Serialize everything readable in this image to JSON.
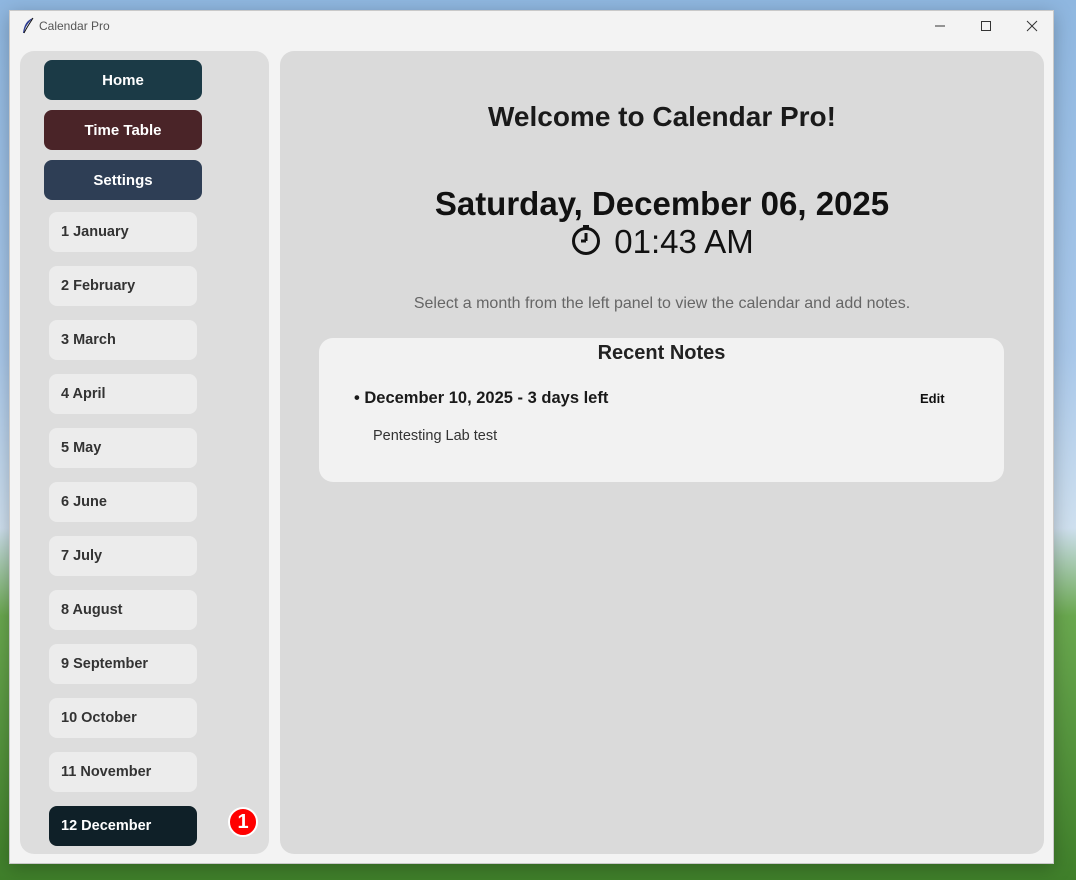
{
  "window": {
    "title": "Calendar Pro"
  },
  "sidebar": {
    "nav": [
      {
        "label": "Home",
        "color": "#1b3a46"
      },
      {
        "label": "Time Table",
        "color": "#4a2428"
      },
      {
        "label": "Settings",
        "color": "#2e3e55"
      }
    ],
    "months": [
      {
        "label": "1 January"
      },
      {
        "label": "2 February"
      },
      {
        "label": "3 March"
      },
      {
        "label": "4 April"
      },
      {
        "label": "5 May"
      },
      {
        "label": "6 June"
      },
      {
        "label": "7 July"
      },
      {
        "label": "8 August"
      },
      {
        "label": "9 September"
      },
      {
        "label": "10 October"
      },
      {
        "label": "11 November"
      },
      {
        "label": "12 December",
        "active": true
      }
    ],
    "notification_badge": "1"
  },
  "main": {
    "welcome": "Welcome to Calendar Pro!",
    "date": "Saturday, December 06, 2025",
    "time": "01:43 AM",
    "time_icon": "clock-icon",
    "hint": "Select a month from the left panel to view the calendar and add notes.",
    "recent_notes": {
      "title": "Recent Notes",
      "items": [
        {
          "header": "• December 10, 2025 - 3 days left",
          "edit_label": "Edit",
          "text": "Pentesting Lab test"
        }
      ]
    }
  }
}
